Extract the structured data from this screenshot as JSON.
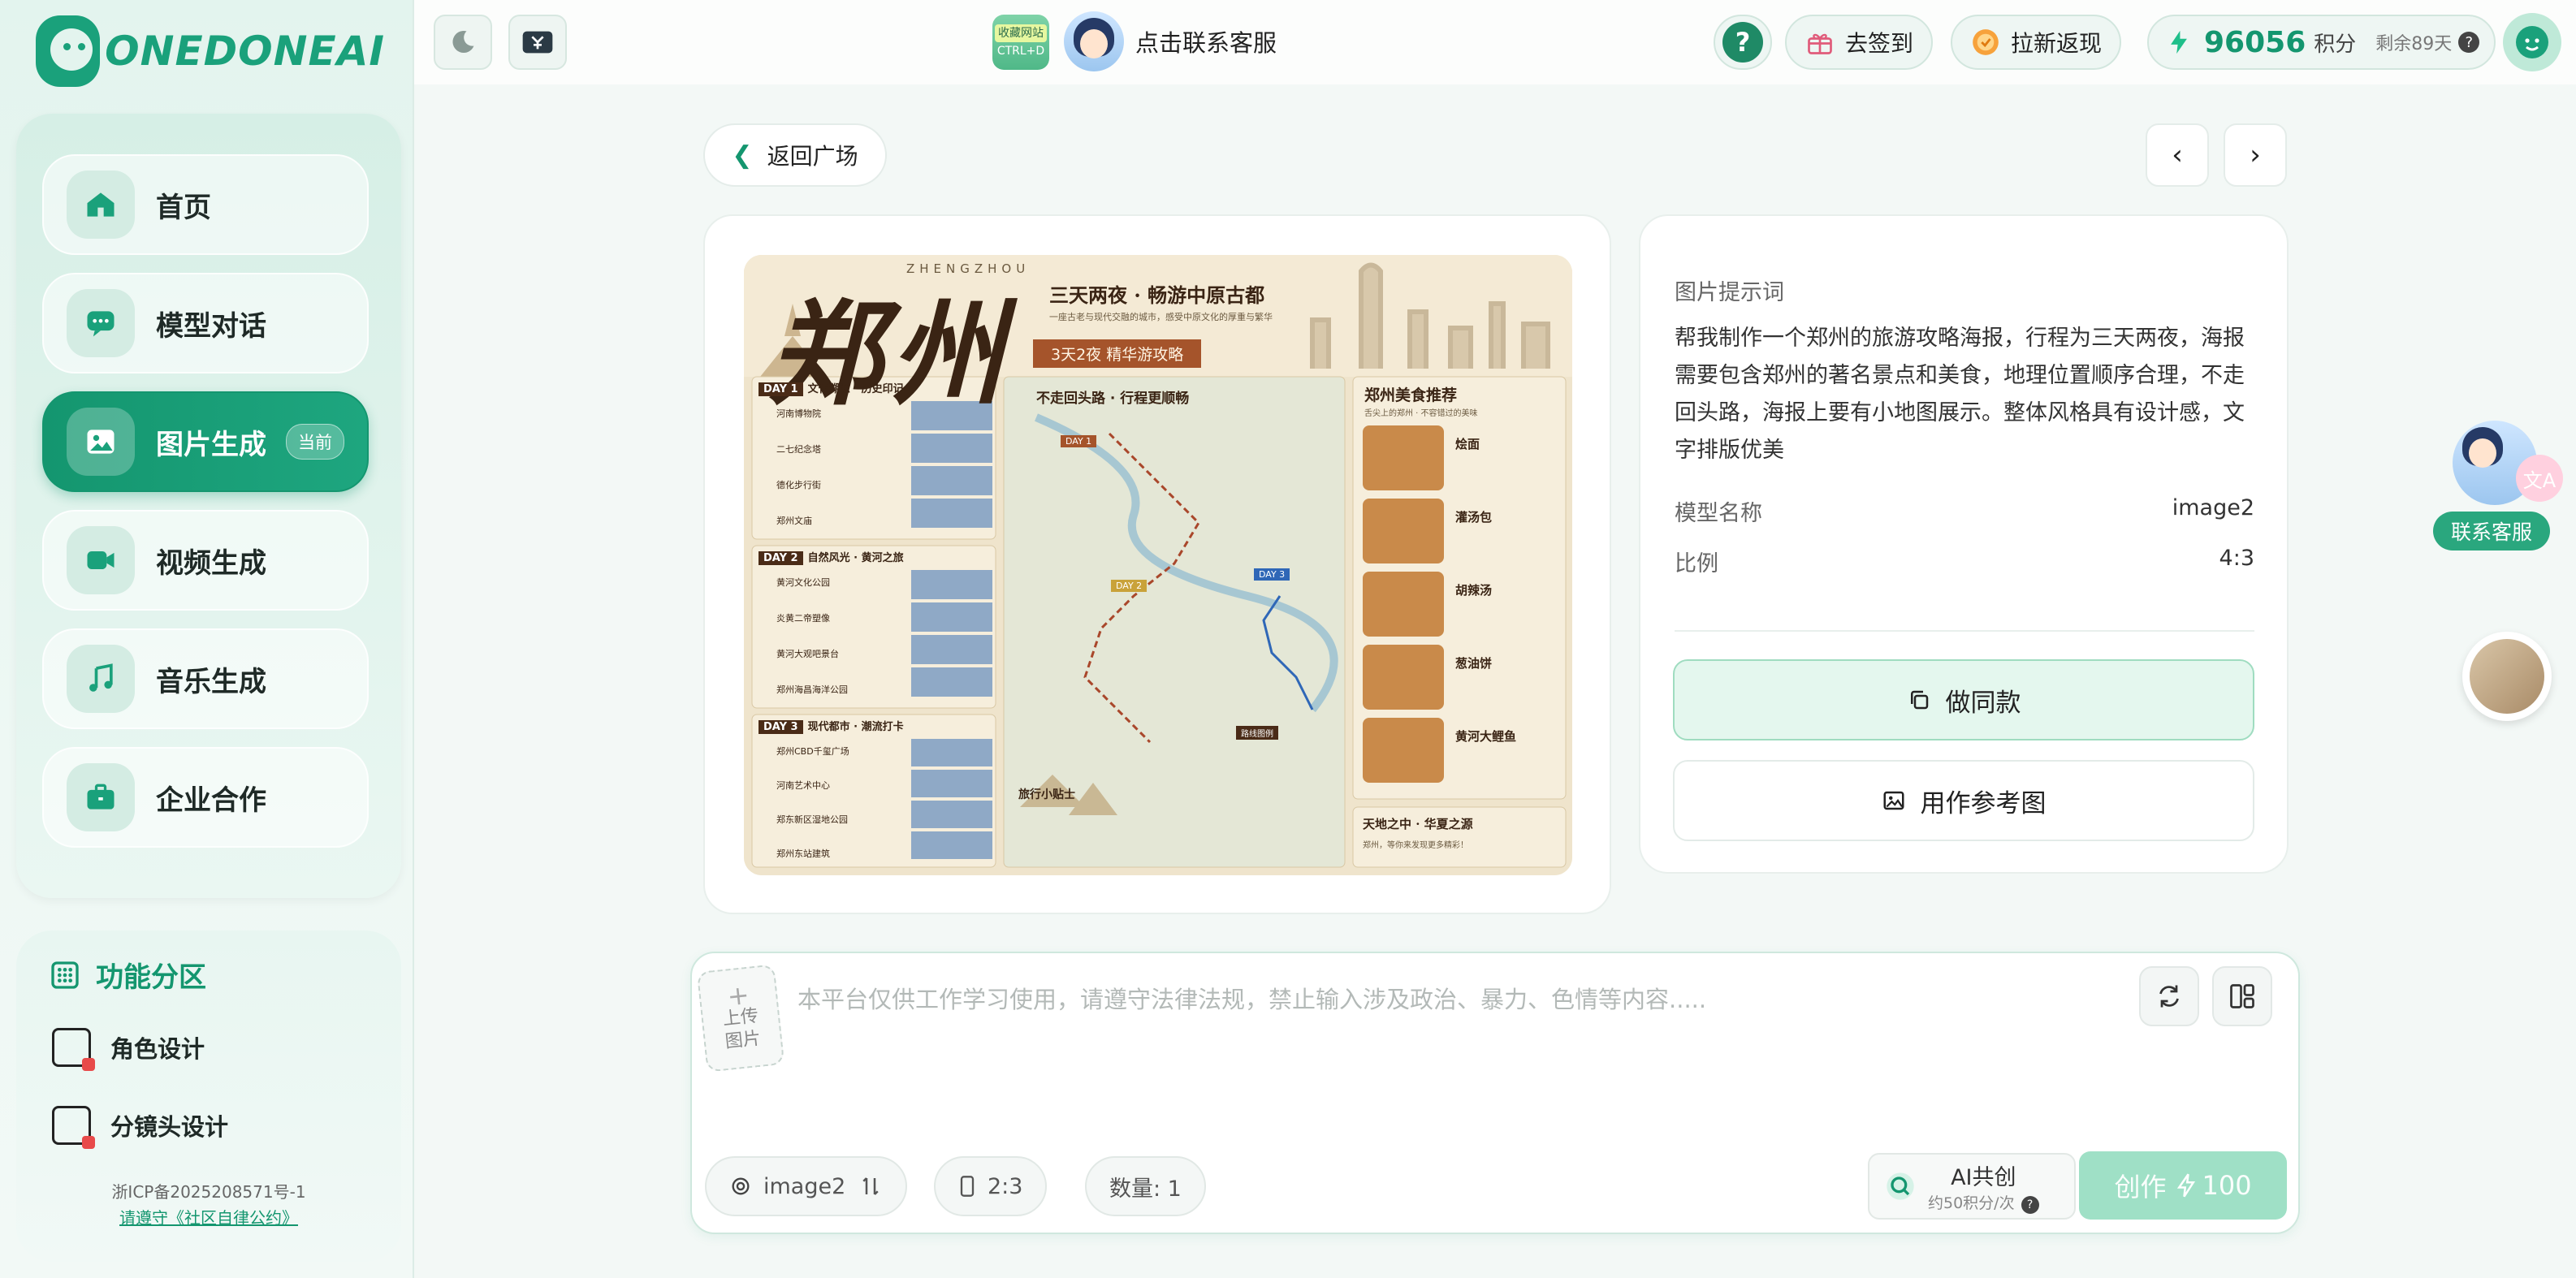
{
  "brand": {
    "name": "ONEDONEAI",
    "color": "#1aa17b"
  },
  "sidebar": {
    "items": [
      {
        "label": "首页",
        "icon": "home-icon"
      },
      {
        "label": "模型对话",
        "icon": "chat-icon"
      },
      {
        "label": "图片生成",
        "icon": "image-icon",
        "badge": "当前"
      },
      {
        "label": "视频生成",
        "icon": "video-icon"
      },
      {
        "label": "音乐生成",
        "icon": "music-icon"
      },
      {
        "label": "企业合作",
        "icon": "briefcase-icon"
      }
    ],
    "func_title": "功能分区",
    "func_items": [
      {
        "label": "角色设计",
        "icon": "character-design-icon"
      },
      {
        "label": "分镜头设计",
        "icon": "storyboard-icon"
      }
    ],
    "icp": "浙ICP备2025208571号-1",
    "rules_link": "请遵守《社区自律公约》"
  },
  "topbar": {
    "bookmark_top": "收藏网站",
    "bookmark_shortcut": "CTRL+D",
    "contact": "点击联系客服",
    "signin": "去签到",
    "invite": "拉新返现",
    "points": "96056",
    "points_unit": "积分",
    "days_left": "剩余89天",
    "help": "?"
  },
  "main": {
    "back": "返回广场",
    "poster": {
      "city": "郑州",
      "pinyin": "ZHENGZHOU",
      "headline": "三天两夜 · 畅游中原古都",
      "tagline": "一座古老与现代交融的城市，感受中原文化的厚重与繁华",
      "ribbon": "3天2夜 精华游攻略",
      "map_title": "不走回头路 · 行程更顺畅",
      "food_title": "郑州美食推荐",
      "food_sub": "舌尖上的郑州 · 不容错过的美味",
      "foods": [
        "烩面",
        "灌汤包",
        "胡辣汤",
        "葱油饼",
        "黄河大鲤鱼"
      ],
      "days": [
        {
          "tag": "DAY 1",
          "title": "文化溯源 · 历史印记",
          "spots": [
            "河南博物院",
            "二七纪念塔",
            "德化步行街",
            "郑州文庙"
          ]
        },
        {
          "tag": "DAY 2",
          "title": "自然风光 · 黄河之旅",
          "spots": [
            "黄河文化公园",
            "炎黄二帝塑像",
            "黄河大观吧景台",
            "郑州海昌海洋公园"
          ]
        },
        {
          "tag": "DAY 3",
          "title": "现代都市 · 潮流打卡",
          "spots": [
            "郑州CBD千玺广场",
            "河南艺术中心",
            "郑东新区湿地公园",
            "郑州东站建筑"
          ]
        }
      ],
      "map_labels": [
        "DAY 1",
        "DAY 2",
        "DAY 3"
      ],
      "tips_title": "旅行小贴士",
      "legend_title": "路线图例",
      "footer": "天地之中 · 华夏之源",
      "footer_sub": "郑州，等你来发现更多精彩！"
    },
    "info": {
      "prompt_label": "图片提示词",
      "prompt": "帮我制作一个郑州的旅游攻略海报，行程为三天两夜，海报需要包含郑州的著名景点和美食，地理位置顺序合理，不走回头路，海报上要有小地图展示。整体风格具有设计感，文字排版优美",
      "model_label": "模型名称",
      "model": "image2",
      "ratio_label": "比例",
      "ratio": "4:3",
      "same_btn": "做同款",
      "ref_btn": "用作参考图"
    }
  },
  "composer": {
    "upload_plus": "+",
    "upload_label1": "上传",
    "upload_label2": "图片",
    "placeholder": "本平台仅供工作学习使用，请遵守法律法规，禁止输入涉及政治、暴力、色情等内容.....",
    "model": "image2",
    "ratio": "2:3",
    "count": "数量: 1",
    "ai_co": "AI共创",
    "ai_co_cost": "约50积分/次",
    "create": "创作",
    "create_cost": "100"
  },
  "float": {
    "contact": "联系客服",
    "lang": "文A"
  }
}
